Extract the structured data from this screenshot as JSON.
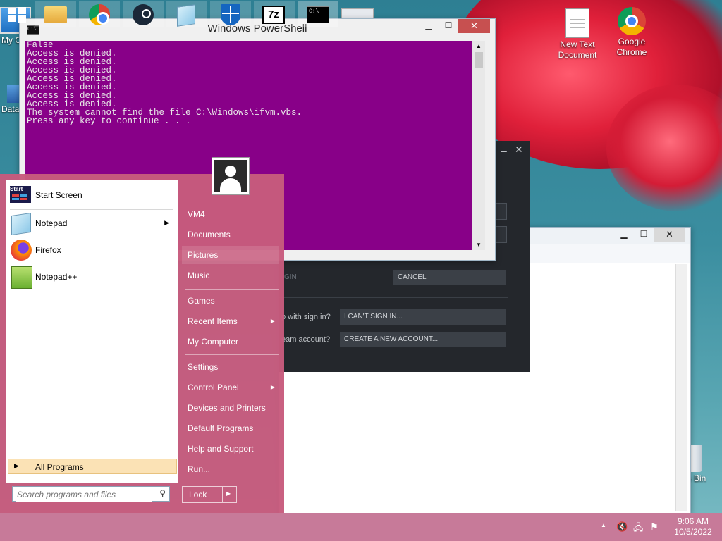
{
  "desktop": {
    "icons": [
      {
        "name": "my-computer",
        "label": "My C"
      },
      {
        "name": "data",
        "label": "Data"
      },
      {
        "name": "new-text-document",
        "label": "New Text Document"
      },
      {
        "name": "google-chrome",
        "label": "Google Chrome"
      },
      {
        "name": "recycle-bin",
        "label": "e Bin"
      }
    ]
  },
  "powershell": {
    "title": "Windows PowerShell",
    "lines": [
      "False",
      "Access is denied.",
      "Access is denied.",
      "Access is denied.",
      "Access is denied.",
      "Access is denied.",
      "Access is denied.",
      "Access is denied.",
      "The system cannot find the file C:\\Windows\\ifvm.vbs.",
      "Press any key to continue . . ."
    ],
    "bg_color": "#880088"
  },
  "steam": {
    "login_label": "GIN",
    "cancel": "CANCEL",
    "help_label": "p with sign in?",
    "cant_sign_in": "I CAN'T SIGN IN...",
    "account_label": "eam account?",
    "create_account": "CREATE A NEW ACCOUNT..."
  },
  "start_menu": {
    "left_items": [
      {
        "name": "start-screen",
        "label": "Start Screen",
        "icon": "start-screen-icon"
      },
      {
        "name": "notepad",
        "label": "Notepad",
        "icon": "notepad-icon",
        "has_submenu": true
      },
      {
        "name": "firefox",
        "label": "Firefox",
        "icon": "firefox-icon"
      },
      {
        "name": "notepad-plus-plus",
        "label": "Notepad++",
        "icon": "notepad-plus-plus-icon"
      }
    ],
    "start_icon_text": "Start",
    "all_programs": "All Programs",
    "search_placeholder": "Search programs and files",
    "right_items": [
      {
        "name": "vm4",
        "label": "VM4"
      },
      {
        "name": "documents",
        "label": "Documents"
      },
      {
        "name": "pictures",
        "label": "Pictures"
      },
      {
        "name": "music",
        "label": "Music"
      },
      {
        "name": "games",
        "label": "Games"
      },
      {
        "name": "recent-items",
        "label": "Recent Items",
        "has_submenu": true
      },
      {
        "name": "my-computer",
        "label": "My Computer"
      },
      {
        "name": "settings",
        "label": "Settings"
      },
      {
        "name": "control-panel",
        "label": "Control Panel",
        "has_submenu": true
      },
      {
        "name": "devices-and-printers",
        "label": "Devices and Printers"
      },
      {
        "name": "default-programs",
        "label": "Default Programs"
      },
      {
        "name": "help-and-support",
        "label": "Help and Support"
      },
      {
        "name": "run",
        "label": "Run..."
      }
    ],
    "lock": "Lock"
  },
  "taskbar": {
    "items": [
      "windows-logo-icon",
      "file-explorer-icon",
      "chrome-icon",
      "steam-icon",
      "notepad-icon",
      "security-shield-icon",
      "7zip-icon",
      "cmd-icon"
    ],
    "seven_zip_text": "7z",
    "cmd_text": "C:\\_",
    "time": "9:06 AM",
    "date": "10/5/2022"
  }
}
